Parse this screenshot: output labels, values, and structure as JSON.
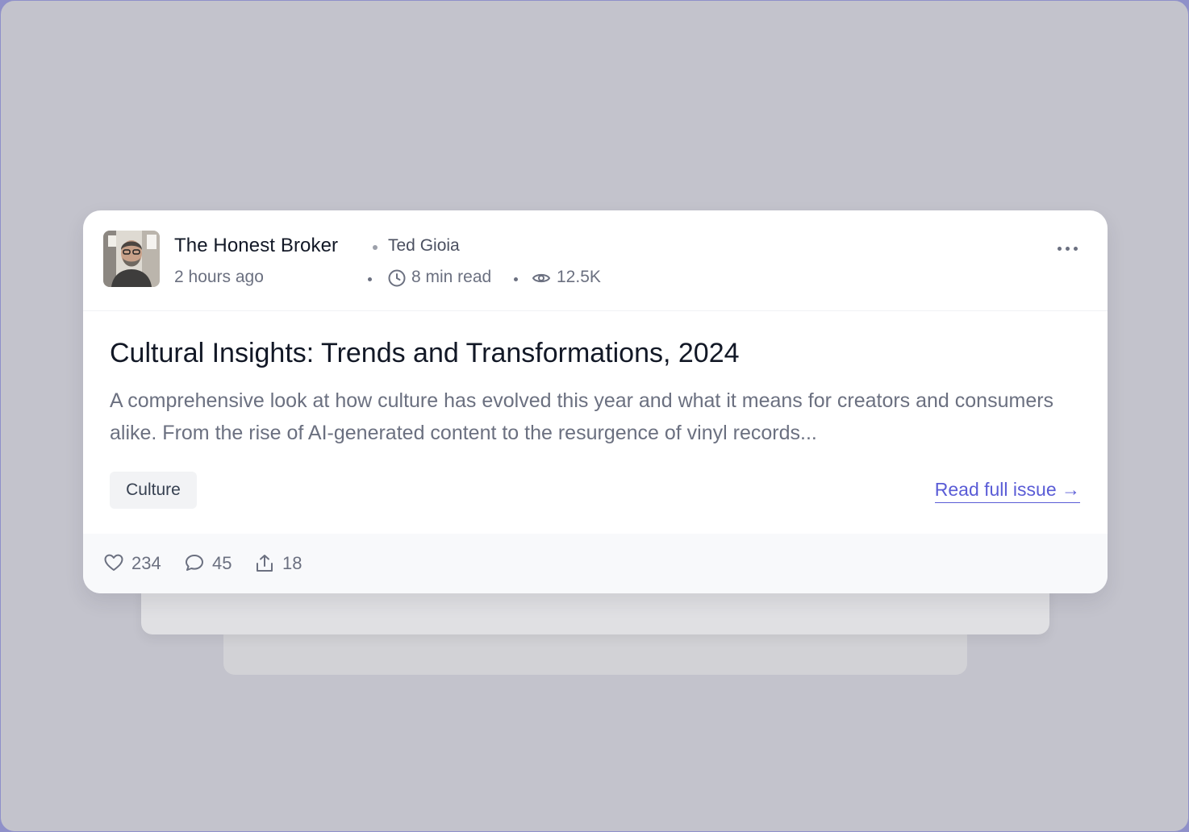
{
  "publication": {
    "name": "The Honest Broker",
    "author": "Ted Gioia"
  },
  "meta": {
    "posted": "2 hours ago",
    "read_time": "8 min read",
    "views": "12.5K"
  },
  "post": {
    "title": "Cultural Insights: Trends and Transformations, 2024",
    "excerpt": "A comprehensive look at how culture has evolved this year and what it means for creators and consumers alike. From the rise of AI-generated content to the resurgence of vinyl records...",
    "tag": "Culture",
    "read_link": "Read full issue →"
  },
  "stats": {
    "likes": "234",
    "comments": "45",
    "shares": "18"
  },
  "icons": {
    "avatar": "author-photo",
    "menu": "more-icon",
    "time": "clock-icon",
    "views": "eye-icon",
    "like": "heart-icon",
    "comment": "comment-icon",
    "share": "share-icon"
  },
  "colors": {
    "accent": "#5a5cd6",
    "page_background": "#c3c3cc",
    "card_background": "#ffffff"
  }
}
